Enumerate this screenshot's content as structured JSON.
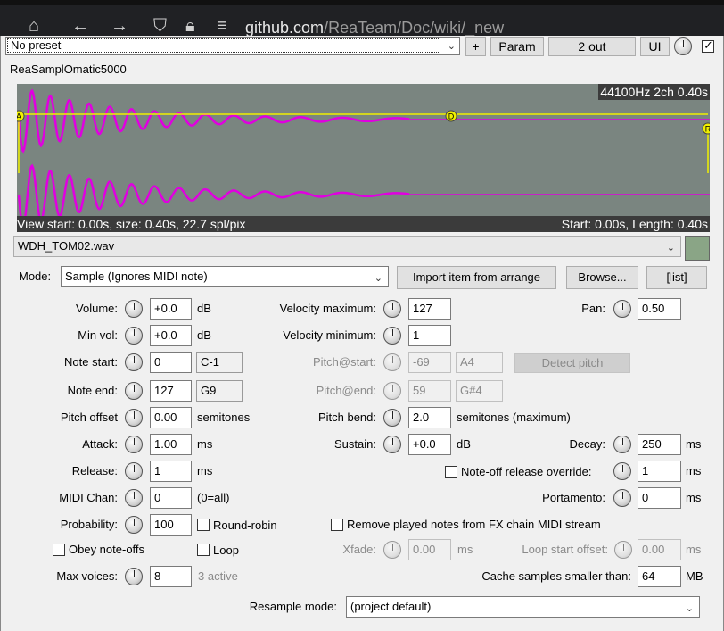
{
  "browser": {
    "url_host": "github.com",
    "url_path": "/ReaTeam/Doc/wiki/_new"
  },
  "toolbar": {
    "preset": "No preset",
    "add_label": "+",
    "param_label": "Param",
    "out_label": "2 out",
    "ui_label": "UI",
    "enabled": true
  },
  "plugin_name": "ReaSamplOmatic5000",
  "waveform": {
    "info": "44100Hz 2ch 0.40s",
    "view_info": "View start: 0.00s, size: 0.40s, 22.7 spl/pix",
    "range_info": "Start: 0.00s, Length: 0.40s",
    "marker_a": "A",
    "marker_d": "D",
    "marker_r": "R",
    "colors": {
      "background": "#7a8580",
      "wave": "#e000e0",
      "envelope": "#f0f000"
    }
  },
  "file": {
    "name": "WDH_TOM02.wav"
  },
  "mode": {
    "label": "Mode:",
    "value": "Sample (Ignores MIDI note)",
    "import_label": "Import item from arrange",
    "browse_label": "Browse...",
    "list_label": "[list]"
  },
  "volume": {
    "label": "Volume:",
    "value": "+0.0",
    "unit": "dB"
  },
  "min_vol": {
    "label": "Min vol:",
    "value": "+0.0",
    "unit": "dB"
  },
  "note_start": {
    "label": "Note start:",
    "value": "0",
    "note": "C-1"
  },
  "note_end": {
    "label": "Note end:",
    "value": "127",
    "note": "G9"
  },
  "pitch_offset": {
    "label": "Pitch offset",
    "value": "0.00",
    "unit": "semitones"
  },
  "attack": {
    "label": "Attack:",
    "value": "1.00",
    "unit": "ms"
  },
  "release": {
    "label": "Release:",
    "value": "1",
    "unit": "ms"
  },
  "midi_chan": {
    "label": "MIDI Chan:",
    "value": "0",
    "hint": "(0=all)"
  },
  "probability": {
    "label": "Probability:",
    "value": "100",
    "round_robin": "Round-robin"
  },
  "obey_note_offs": "Obey note-offs",
  "loop": "Loop",
  "max_voices": {
    "label": "Max voices:",
    "value": "8",
    "active": "3 active"
  },
  "vel_max": {
    "label": "Velocity maximum:",
    "value": "127"
  },
  "vel_min": {
    "label": "Velocity minimum:",
    "value": "1"
  },
  "pitch_start": {
    "label": "Pitch@start:",
    "value": "-69",
    "note": "A4"
  },
  "detect_pitch": "Detect pitch",
  "pitch_end": {
    "label": "Pitch@end:",
    "value": "59",
    "note": "G#4"
  },
  "pitch_bend": {
    "label": "Pitch bend:",
    "value": "2.0",
    "unit": "semitones (maximum)"
  },
  "sustain": {
    "label": "Sustain:",
    "value": "+0.0",
    "unit": "dB"
  },
  "note_off_override": {
    "label": "Note-off release override:",
    "value": "1",
    "unit": "ms"
  },
  "remove_notes": "Remove played notes from FX chain MIDI stream",
  "xfade": {
    "label": "Xfade:",
    "value": "0.00",
    "unit": "ms"
  },
  "loop_start": {
    "label": "Loop start offset:",
    "value": "0.00",
    "unit": "ms"
  },
  "cache": {
    "label": "Cache samples smaller than:",
    "value": "64",
    "unit": "MB"
  },
  "pan": {
    "label": "Pan:",
    "value": "0.50"
  },
  "decay": {
    "label": "Decay:",
    "value": "250",
    "unit": "ms"
  },
  "portamento": {
    "label": "Portamento:",
    "value": "0",
    "unit": "ms"
  },
  "resample": {
    "label": "Resample mode:",
    "value": "(project default)"
  }
}
